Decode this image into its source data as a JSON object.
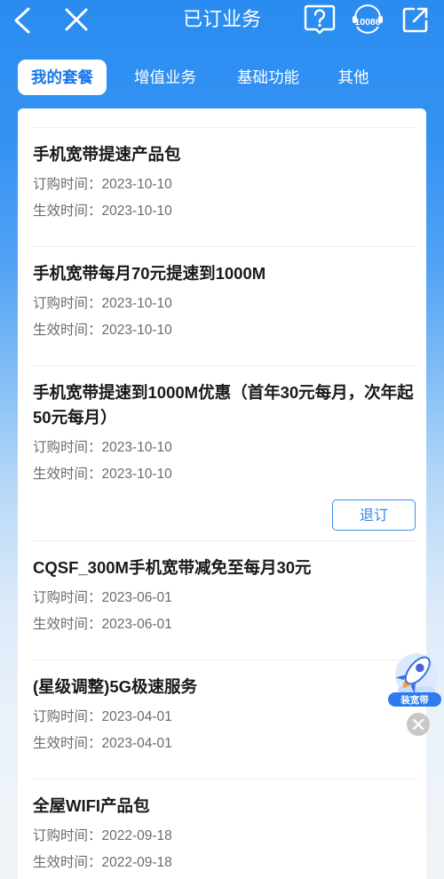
{
  "header": {
    "title": "已订业务",
    "hotline_label": "10086",
    "icons": {
      "back": "back-chevron-icon",
      "close": "close-icon",
      "help": "help-question-icon",
      "hotline": "hotline-10086-icon",
      "share": "share-icon"
    }
  },
  "tabs": [
    {
      "label": "我的套餐",
      "active": true
    },
    {
      "label": "增值业务",
      "active": false
    },
    {
      "label": "基础功能",
      "active": false
    },
    {
      "label": "其他",
      "active": false
    }
  ],
  "services": [
    {
      "title": "手机宽带提速产品包",
      "order_label": "订购时间：",
      "order_date": "2023-10-10",
      "effective_label": "生效时间：",
      "effective_date": "2023-10-10"
    },
    {
      "title": "手机宽带每月70元提速到1000M",
      "order_label": "订购时间：",
      "order_date": "2023-10-10",
      "effective_label": "生效时间：",
      "effective_date": "2023-10-10"
    },
    {
      "title": "手机宽带提速到1000M优惠（首年30元每月，次年起50元每月）",
      "order_label": "订购时间：",
      "order_date": "2023-10-10",
      "effective_label": "生效时间：",
      "effective_date": "2023-10-10",
      "action_label": "退订"
    },
    {
      "title": "CQSF_300M手机宽带减免至每月30元",
      "order_label": "订购时间：",
      "order_date": "2023-06-01",
      "effective_label": "生效时间：",
      "effective_date": "2023-06-01"
    },
    {
      "title": "(星级调整)5G极速服务",
      "order_label": "订购时间：",
      "order_date": "2023-04-01",
      "effective_label": "生效时间：",
      "effective_date": "2023-04-01"
    },
    {
      "title": "全屋WIFI产品包",
      "order_label": "订购时间：",
      "order_date": "2022-09-18",
      "effective_label": "生效时间：",
      "effective_date": "2022-09-18"
    }
  ],
  "float_widget": {
    "label": "装宽带",
    "icon": "rocket-icon",
    "close_icon": "close-circle-icon"
  },
  "colors": {
    "header_blue": "#2a8cf0",
    "tab_active_text": "#1976e8",
    "title_text": "#1a1a1a",
    "meta_text": "#6b6b6b",
    "button_blue": "#2f86ea",
    "page_bottom": "#f0f4f8"
  }
}
